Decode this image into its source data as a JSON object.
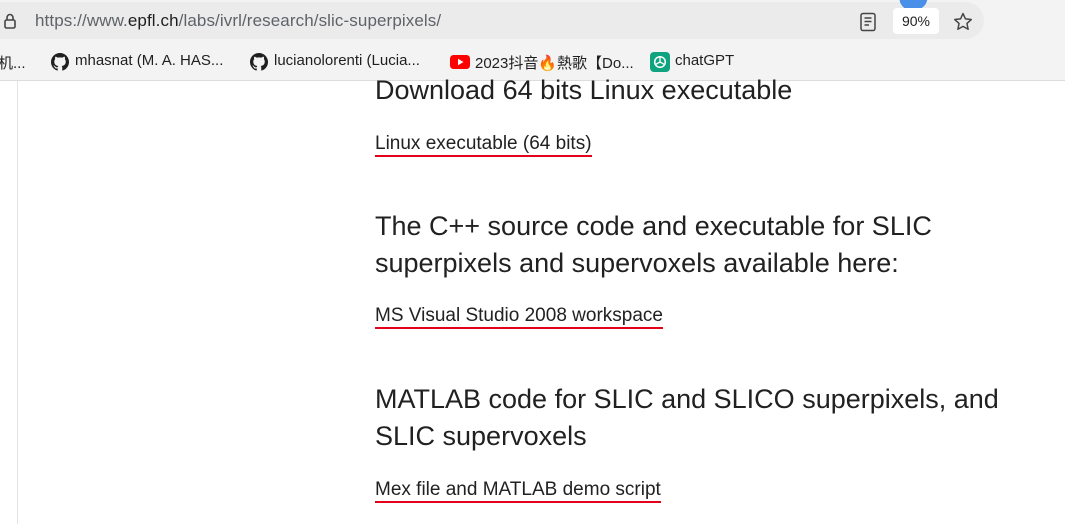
{
  "browser": {
    "url_scheme": "https://www.",
    "url_host": "epfl.ch",
    "url_path": "/labs/ivrl/research/slic-superpixels/",
    "zoom_label": "90%",
    "icons": [
      "lock-icon",
      "reader-mode-icon",
      "star-icon"
    ]
  },
  "bookmarks": [
    {
      "label": "机...",
      "icon": "none"
    },
    {
      "label": "mhasnat (M. A. HAS...",
      "icon": "github-icon"
    },
    {
      "label": "lucianolorenti (Lucia...",
      "icon": "github-icon"
    },
    {
      "label": "2023抖音🔥熱歌【Do...",
      "icon": "youtube-icon"
    },
    {
      "label": "chatGPT",
      "icon": "chatgpt-icon"
    }
  ],
  "content": {
    "sections": [
      {
        "heading": "Download 64 bits Linux executable",
        "link": "Linux executable (64 bits)"
      },
      {
        "heading_line1": "The C++ source code and executable for SLIC",
        "heading_line2": "superpixels and supervoxels available here:",
        "link": "MS Visual Studio 2008 workspace"
      },
      {
        "heading_line1": "MATLAB code for SLIC and SLICO superpixels, and",
        "heading_line2": "SLIC supervoxels",
        "link": "Mex file and MATLAB demo script"
      }
    ]
  },
  "colors": {
    "link_underline": "#e2001a",
    "text": "#212121",
    "youtube_red": "#ff0000",
    "chatgpt_teal": "#10a37f"
  }
}
